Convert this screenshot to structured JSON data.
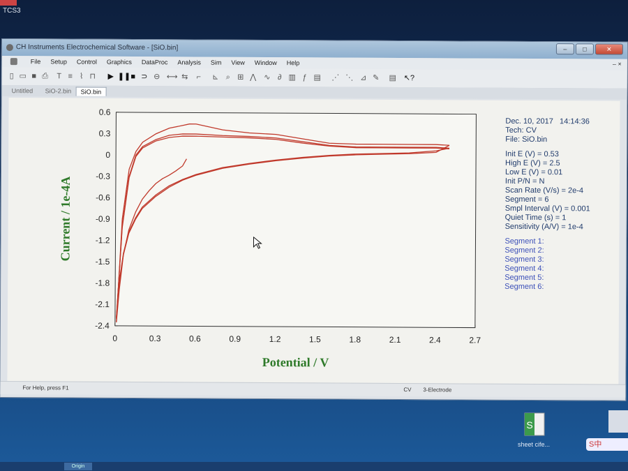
{
  "desktop": {
    "top_label": "TCS3",
    "icon_label": "sheet cife...",
    "ime_label": "S中",
    "taskbar_item": "Origin"
  },
  "window": {
    "title": "CH Instruments Electrochemical Software - [SiO.bin]",
    "menu": [
      "File",
      "Setup",
      "Control",
      "Graphics",
      "DataProc",
      "Analysis",
      "Sim",
      "View",
      "Window",
      "Help"
    ],
    "tabs": [
      "Untitled",
      "SiO-2.bin",
      "SiO.bin"
    ],
    "active_tab": 2,
    "status_left": "For Help, press F1",
    "status_mid": "CV",
    "status_right": "3-Electrode"
  },
  "info": {
    "lines": [
      "Dec. 10, 2017   14:14:36",
      "Tech: CV",
      "File: SiO.bin"
    ],
    "params": [
      "Init E (V) = 0.53",
      "High E (V) = 2.5",
      "Low E (V) = 0.01",
      "Init P/N = N",
      "Scan Rate (V/s) = 2e-4",
      "Segment = 6",
      "Smpl Interval (V) = 0.001",
      "Quiet Time (s) = 1",
      "Sensitivity (A/V) = 1e-4"
    ],
    "segments": [
      "Segment 1:",
      "Segment 2:",
      "Segment 3:",
      "Segment 4:",
      "Segment 5:",
      "Segment 6:"
    ]
  },
  "chart_data": {
    "type": "line",
    "xlabel": "Potential / V",
    "ylabel": "Current / 1e-4A",
    "xlim": [
      0,
      2.7
    ],
    "ylim": [
      -2.4,
      0.6
    ],
    "xticks": [
      "0",
      "0.3",
      "0.6",
      "0.9",
      "1.2",
      "1.5",
      "1.8",
      "2.1",
      "2.4",
      "2.7"
    ],
    "yticks": [
      "0.6",
      "0.3",
      "0",
      "-0.3",
      "-0.6",
      "-0.9",
      "-1.2",
      "-1.5",
      "-1.8",
      "-2.1",
      "-2.4"
    ],
    "line_color": "#c0392b",
    "series": [
      {
        "x": [
          0.53,
          0.5,
          0.45,
          0.4,
          0.35,
          0.3,
          0.25,
          0.2,
          0.15,
          0.1,
          0.06,
          0.03,
          0.01
        ],
        "y": [
          -0.05,
          -0.15,
          -0.22,
          -0.28,
          -0.33,
          -0.4,
          -0.5,
          -0.62,
          -0.8,
          -1.05,
          -1.4,
          -1.9,
          -2.35
        ]
      },
      {
        "x": [
          0.01,
          0.05,
          0.1,
          0.15,
          0.2,
          0.3,
          0.4,
          0.5,
          0.55,
          0.6,
          0.8,
          1.0,
          1.2,
          1.4,
          1.6,
          1.8,
          2.0,
          2.2,
          2.4,
          2.5
        ],
        "y": [
          -2.35,
          -0.9,
          -0.2,
          0.05,
          0.18,
          0.3,
          0.38,
          0.42,
          0.44,
          0.44,
          0.36,
          0.32,
          0.3,
          0.24,
          0.18,
          0.17,
          0.17,
          0.17,
          0.17,
          0.16
        ]
      },
      {
        "x": [
          2.5,
          2.4,
          2.2,
          2.0,
          1.8,
          1.6,
          1.4,
          1.2,
          1.0,
          0.8,
          0.6,
          0.5,
          0.4,
          0.3,
          0.2,
          0.15,
          0.1,
          0.06,
          0.03,
          0.01
        ],
        "y": [
          0.16,
          0.06,
          0.04,
          0.03,
          0.02,
          0.0,
          -0.03,
          -0.07,
          -0.12,
          -0.18,
          -0.28,
          -0.35,
          -0.45,
          -0.58,
          -0.75,
          -0.9,
          -1.1,
          -1.4,
          -1.8,
          -2.3
        ]
      },
      {
        "x": [
          0.01,
          0.05,
          0.1,
          0.15,
          0.2,
          0.3,
          0.4,
          0.5,
          0.6,
          0.8,
          1.0,
          1.2,
          1.4,
          1.6,
          1.8,
          2.0,
          2.2,
          2.4,
          2.5
        ],
        "y": [
          -2.3,
          -1.0,
          -0.3,
          0.0,
          0.12,
          0.22,
          0.28,
          0.3,
          0.3,
          0.28,
          0.27,
          0.25,
          0.2,
          0.15,
          0.13,
          0.13,
          0.13,
          0.13,
          0.12
        ]
      },
      {
        "x": [
          2.5,
          2.4,
          2.2,
          2.0,
          1.8,
          1.6,
          1.4,
          1.2,
          1.0,
          0.8,
          0.6,
          0.5,
          0.4,
          0.3,
          0.2,
          0.15,
          0.1,
          0.06,
          0.03,
          0.01
        ],
        "y": [
          0.12,
          0.08,
          0.05,
          0.04,
          0.03,
          0.01,
          -0.02,
          -0.06,
          -0.11,
          -0.17,
          -0.27,
          -0.34,
          -0.43,
          -0.56,
          -0.73,
          -0.88,
          -1.08,
          -1.38,
          -1.78,
          -2.28
        ]
      },
      {
        "x": [
          0.01,
          0.05,
          0.1,
          0.15,
          0.2,
          0.3,
          0.4,
          0.5,
          0.6,
          0.8,
          1.0,
          1.2,
          1.4,
          1.6,
          1.8,
          2.0,
          2.2,
          2.4,
          2.5
        ],
        "y": [
          -2.28,
          -1.02,
          -0.32,
          -0.02,
          0.1,
          0.2,
          0.25,
          0.27,
          0.27,
          0.26,
          0.25,
          0.23,
          0.18,
          0.14,
          0.12,
          0.12,
          0.12,
          0.12,
          0.11
        ]
      }
    ]
  }
}
